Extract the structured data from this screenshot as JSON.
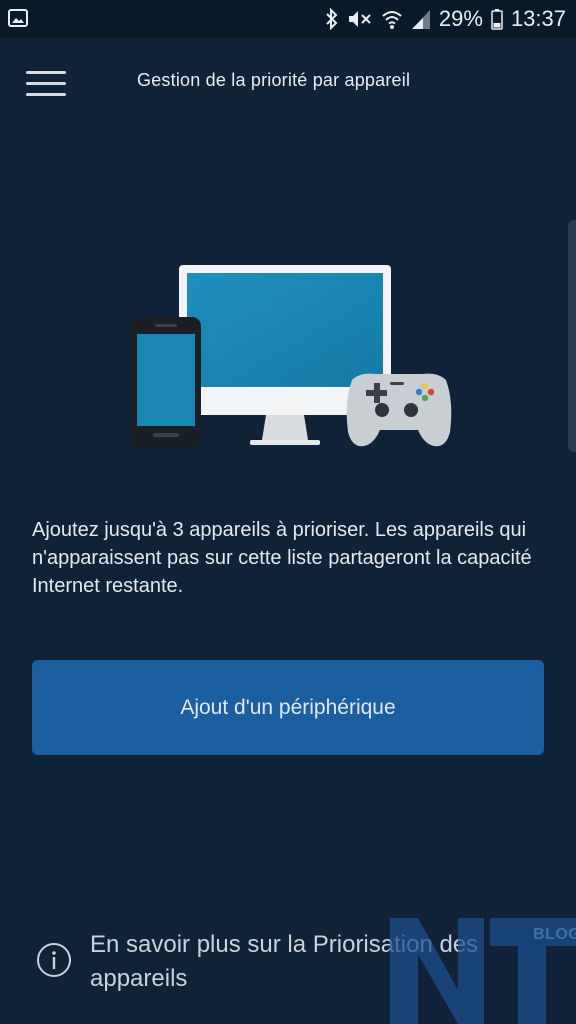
{
  "status_bar": {
    "battery": "29%",
    "time": "13:37",
    "icons": [
      "gallery-icon",
      "bluetooth-icon",
      "mute-icon",
      "wifi-icon",
      "signal-icon",
      "battery-icon"
    ]
  },
  "header": {
    "title": "Gestion de la priorité par appareil",
    "menu_icon": "hamburger-menu-icon"
  },
  "illustration": {
    "icons": [
      "smartphone-icon",
      "monitor-icon",
      "gamepad-icon"
    ]
  },
  "main": {
    "description": "Ajoutez jusqu'à 3 appareils à prioriser. Les appareils qui n'apparaissent pas sur cette liste partageront la capacité Internet restante.",
    "add_button_label": "Ajout d'un périphérique"
  },
  "footer": {
    "learn_more": "En savoir plus sur la Priorisation des appareils",
    "info_icon": "info-icon"
  },
  "watermark": {
    "text": "NT",
    "blog": "BLOG"
  },
  "colors": {
    "background": "#0f2237",
    "status_bar": "#0b1a2b",
    "button": "#1b5fa0",
    "screen": "#1a86b4"
  }
}
